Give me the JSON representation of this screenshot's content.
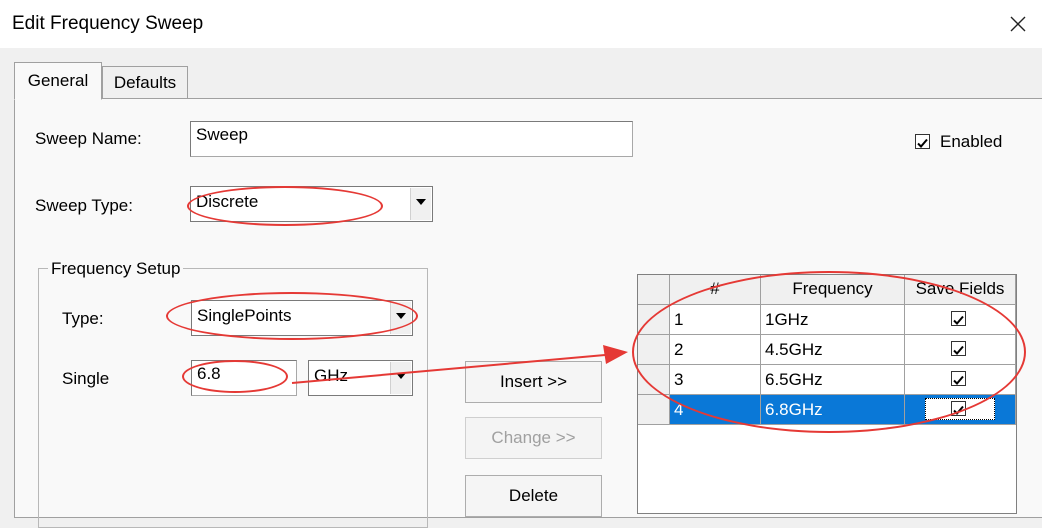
{
  "window": {
    "title": "Edit Frequency Sweep",
    "close_icon": "close-icon"
  },
  "tabs": [
    {
      "label": "General"
    },
    {
      "label": "Defaults"
    }
  ],
  "general": {
    "sweep_name_label": "Sweep Name:",
    "sweep_name_value": "Sweep",
    "enabled_label": "Enabled",
    "enabled_checked": true,
    "sweep_type_label": "Sweep Type:",
    "sweep_type_value": "Discrete"
  },
  "frequency_setup": {
    "title": "Frequency Setup",
    "type_label": "Type:",
    "type_value": "SinglePoints",
    "single_label": "Single",
    "single_value": "6.8",
    "unit_value": "GHz"
  },
  "buttons": {
    "insert": "Insert >>",
    "change": "Change >>",
    "delete": "Delete"
  },
  "grid": {
    "headers": [
      "#",
      "Frequency",
      "Save Fields"
    ],
    "rows": [
      {
        "num": "1",
        "freq": "1GHz",
        "save": true
      },
      {
        "num": "2",
        "freq": "4.5GHz",
        "save": true
      },
      {
        "num": "3",
        "freq": "6.5GHz",
        "save": true
      },
      {
        "num": "4",
        "freq": "6.8GHz",
        "save": true,
        "selected": true
      }
    ]
  },
  "colors": {
    "annotation": "#e53935",
    "selection": "#0a78d7"
  }
}
